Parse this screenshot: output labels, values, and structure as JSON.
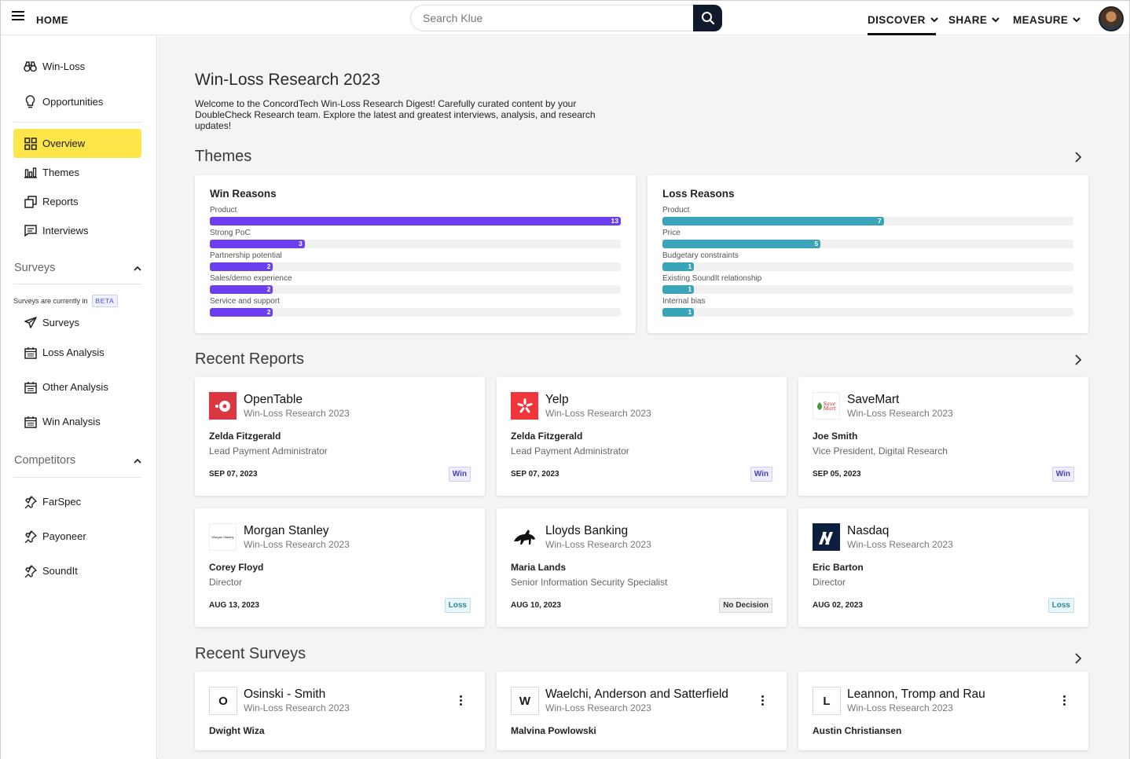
{
  "topbar": {
    "home_label": "HOME",
    "search_placeholder": "Search Klue",
    "nav": {
      "discover": "DISCOVER",
      "share": "SHARE",
      "measure": "MEASURE"
    }
  },
  "sidebar": {
    "top_items": [
      {
        "label": "Win-Loss",
        "icon": "binoculars-icon"
      },
      {
        "label": "Opportunities",
        "icon": "lightbulb-icon"
      }
    ],
    "main_items": [
      {
        "label": "Overview",
        "icon": "grid-icon",
        "active": true
      },
      {
        "label": "Themes",
        "icon": "bar-chart-icon"
      },
      {
        "label": "Reports",
        "icon": "copy-icon"
      },
      {
        "label": "Interviews",
        "icon": "chat-icon"
      }
    ],
    "surveys_section": "Surveys",
    "surveys_note": "Surveys are currently in",
    "beta": "BETA",
    "survey_items": [
      {
        "label": "Surveys",
        "icon": "send-icon"
      },
      {
        "label": "Loss Analysis",
        "icon": "calendar-icon"
      },
      {
        "label": "Other Analysis",
        "icon": "calendar-icon"
      },
      {
        "label": "Win Analysis",
        "icon": "calendar-icon"
      }
    ],
    "competitors_section": "Competitors",
    "competitor_items": [
      {
        "label": "FarSpec",
        "icon": "pin-icon"
      },
      {
        "label": "Payoneer",
        "icon": "pin-icon"
      },
      {
        "label": "SoundIt",
        "icon": "pin-icon"
      }
    ]
  },
  "main": {
    "title": "Win-Loss Research 2023",
    "description": "Welcome to the ConcordTech Win-Loss Research Digest! Carefully curated content by your DoubleCheck Research team. Explore the latest and greatest interviews, analysis, and research updates!",
    "themes_title": "Themes",
    "win_reasons": {
      "title": "Win Reasons",
      "color": "#6b3ff0",
      "max": 13,
      "items": [
        {
          "label": "Product",
          "value": 13
        },
        {
          "label": "Strong PoC",
          "value": 3
        },
        {
          "label": "Partnership potential",
          "value": 2
        },
        {
          "label": "Sales/demo experience",
          "value": 2
        },
        {
          "label": "Service and support",
          "value": 2
        }
      ]
    },
    "loss_reasons": {
      "title": "Loss Reasons",
      "color": "#3aa4b8",
      "max": 13,
      "items": [
        {
          "label": "Product",
          "value": 7
        },
        {
          "label": "Price",
          "value": 5
        },
        {
          "label": "Budgetary constraints",
          "value": 1
        },
        {
          "label": "Existing SoundIt relationship",
          "value": 1
        },
        {
          "label": "Internal bias",
          "value": 1
        }
      ]
    },
    "reports_title": "Recent Reports",
    "reports": [
      {
        "company": "OpenTable",
        "sub": "Win-Loss Research 2023",
        "person": "Zelda Fitzgerald",
        "role": "Lead Payment Administrator",
        "date": "SEP 07, 2023",
        "outcome": "Win",
        "logo": "opentable-logo"
      },
      {
        "company": "Yelp",
        "sub": "Win-Loss Research 2023",
        "person": "Zelda Fitzgerald",
        "role": "Lead Payment Administrator",
        "date": "SEP 07, 2023",
        "outcome": "Win",
        "logo": "yelp-logo"
      },
      {
        "company": "SaveMart",
        "sub": "Win-Loss Research 2023",
        "person": "Joe Smith",
        "role": "Vice President, Digital Research",
        "date": "SEP 05, 2023",
        "outcome": "Win",
        "logo": "savemart-logo",
        "logo_text": "Save Mart"
      },
      {
        "company": "Morgan Stanley",
        "sub": "Win-Loss Research 2023",
        "person": "Corey Floyd",
        "role": "Director",
        "date": "AUG 13, 2023",
        "outcome": "Loss",
        "logo": "morgan-stanley-logo",
        "logo_text": "Morgan Stanley"
      },
      {
        "company": "Lloyds Banking",
        "sub": "Win-Loss Research 2023",
        "person": "Maria Lands",
        "role": "Senior Information Security Specialist",
        "date": "AUG 10, 2023",
        "outcome": "No Decision",
        "logo": "lloyds-logo"
      },
      {
        "company": "Nasdaq",
        "sub": "Win-Loss Research 2023",
        "person": "Eric Barton",
        "role": "Director",
        "date": "AUG 02, 2023",
        "outcome": "Loss",
        "logo": "nasdaq-logo"
      }
    ],
    "surveys_title": "Recent Surveys",
    "surveys": [
      {
        "letter": "O",
        "company": "Osinski - Smith",
        "sub": "Win-Loss Research 2023",
        "person": "Dwight Wiza"
      },
      {
        "letter": "W",
        "company": "Waelchi, Anderson and Satterfield",
        "sub": "Win-Loss Research 2023",
        "person": "Malvina Powlowski"
      },
      {
        "letter": "L",
        "company": "Leannon, Tromp and Rau",
        "sub": "Win-Loss Research 2023",
        "person": "Austin Christiansen"
      }
    ]
  }
}
